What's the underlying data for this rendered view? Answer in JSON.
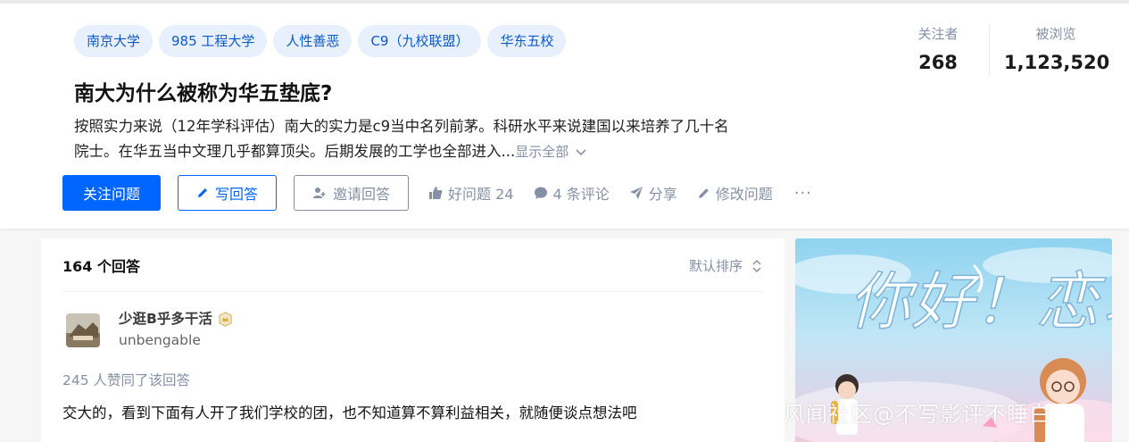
{
  "topics": [
    "南京大学",
    "985 工程大学",
    "人性善恶",
    "C9（九校联盟）",
    "华东五校"
  ],
  "stats": {
    "followers_label": "关注者",
    "followers_value": "268",
    "views_label": "被浏览",
    "views_value": "1,123,520"
  },
  "question": {
    "title": "南大为什么被称为华五垫底?",
    "excerpt_line1": "按照实力来说（12年学科评估）南大的实力是c9当中名列前茅。科研水平来说建国以来培养了几十名",
    "excerpt_line2": "院士。在华五当中文理几乎都算顶尖。后期发展的工学也全部进入...",
    "show_all": "显示全部"
  },
  "actions": {
    "follow": "关注问题",
    "write": "写回答",
    "invite": "邀请回答",
    "upvote": "好问题 24",
    "comments": "4 条评论",
    "share": "分享",
    "edit": "修改问题",
    "more": "···"
  },
  "answers": {
    "count_label": "164 个回答",
    "sort_label": "默认排序",
    "first": {
      "author_name": "少逛B乎多干活",
      "author_handle": "unbengable",
      "likes_line": "245 人赞同了该回答",
      "text": "交大的，看到下面有人开了我们学校的团，也不知道算不算利益相关，就随便谈点想法吧"
    }
  },
  "side_banner": {
    "headline": "你好！恋习生"
  },
  "watermark": "风闻社区@不写影评不睡白",
  "colors": {
    "brand": "#0066ff",
    "topic_bg": "#e8f0fd",
    "topic_text": "#0d59c8",
    "muted": "#8590a6"
  },
  "icons": [
    "chevron-down-icon",
    "pencil-icon",
    "add-person-icon",
    "thumb-up-icon",
    "comment-icon",
    "share-icon",
    "edit-icon",
    "sort-icon",
    "badge-icon"
  ]
}
